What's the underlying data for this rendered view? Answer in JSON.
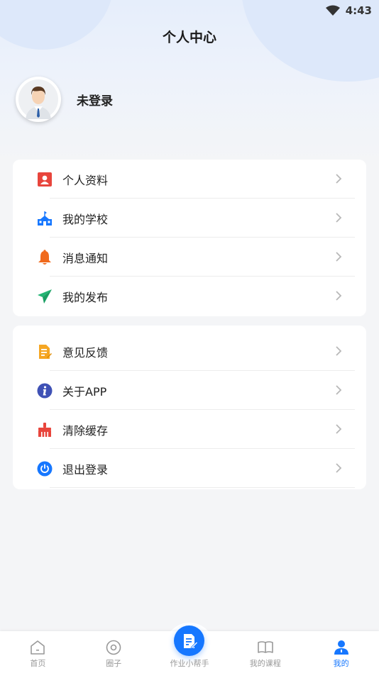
{
  "status_bar": {
    "time": "4:43"
  },
  "header": {
    "title": "个人中心"
  },
  "profile": {
    "login_status": "未登录"
  },
  "menu_group_1": [
    {
      "label": "个人资料",
      "icon": "profile-card-icon",
      "color": "#e8453c"
    },
    {
      "label": "我的学校",
      "icon": "school-icon",
      "color": "#1677ff"
    },
    {
      "label": "消息通知",
      "icon": "bell-icon",
      "color": "#f06a1d"
    },
    {
      "label": "我的发布",
      "icon": "paper-plane-icon",
      "color": "#22b573"
    }
  ],
  "menu_group_2": [
    {
      "label": "意见反馈",
      "icon": "feedback-icon",
      "color": "#f5a623"
    },
    {
      "label": "关于APP",
      "icon": "info-icon",
      "color": "#3f51b5"
    },
    {
      "label": "清除缓存",
      "icon": "broom-icon",
      "color": "#e8453c"
    },
    {
      "label": "退出登录",
      "icon": "power-icon",
      "color": "#1677ff"
    }
  ],
  "tabbar": {
    "home": "首页",
    "circle": "圈子",
    "homework": "作业小帮手",
    "courses": "我的课程",
    "mine": "我的"
  },
  "colors": {
    "accent": "#1677ff",
    "inactive": "#999999"
  }
}
